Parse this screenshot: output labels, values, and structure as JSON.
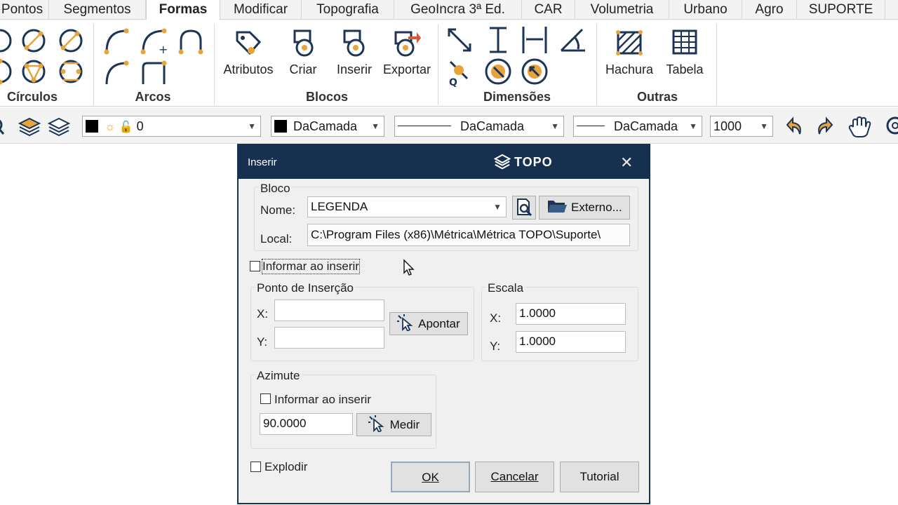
{
  "tabs": [
    {
      "label": "Pontos"
    },
    {
      "label": "Segmentos"
    },
    {
      "label": "Formas"
    },
    {
      "label": "Modificar"
    },
    {
      "label": "Topografia"
    },
    {
      "label": "GeoIncra 3ª Ed."
    },
    {
      "label": "CAR"
    },
    {
      "label": "Volumetria"
    },
    {
      "label": "Urbano"
    },
    {
      "label": "Agro"
    },
    {
      "label": "SUPORTE"
    }
  ],
  "active_tab": "Formas",
  "ribbon": {
    "groups": {
      "circulos": "Círculos",
      "arcos": "Arcos",
      "blocos": "Blocos",
      "dimensoes": "Dimensões",
      "outras": "Outras"
    },
    "buttons": {
      "atributos": "Atributos",
      "criar": "Criar",
      "inserir": "Inserir",
      "exportar": "Exportar",
      "hachura": "Hachura",
      "tabela": "Tabela"
    }
  },
  "properties": {
    "layer": "0",
    "color": "DaCamada",
    "linetype": "DaCamada",
    "lineweight": "DaCamada",
    "scale": "1000"
  },
  "dialog": {
    "title": "Inserir",
    "brand": "TOPO",
    "bloco": {
      "legend": "Bloco",
      "nome_label": "Nome:",
      "nome_value": "LEGENDA",
      "local_label": "Local:",
      "local_value": "C:\\Program Files (x86)\\Métrica\\Métrica TOPO\\Suporte\\",
      "externo_button": "Externo..."
    },
    "informar_inserir_main": "Informar ao inserir",
    "ponto": {
      "legend": "Ponto de Inserção",
      "x_label": "X:",
      "y_label": "Y:",
      "x_value": "",
      "y_value": "",
      "apontar_button": "Apontar"
    },
    "escala": {
      "legend": "Escala",
      "x_label": "X:",
      "y_label": "Y:",
      "x_value": "1.0000",
      "y_value": "1.0000"
    },
    "azimute": {
      "legend": "Azimute",
      "informar_label": "Informar ao inserir",
      "value": "90.0000",
      "medir_button": "Medir"
    },
    "explodir_label": "Explodir",
    "ok_button": "OK",
    "cancelar_button": "Cancelar",
    "tutorial_button": "Tutorial"
  },
  "colors": {
    "titlebar": "#17304f",
    "icon_dark": "#1c3557",
    "icon_accent": "#e8a33b",
    "icon_red": "#d8573b"
  }
}
